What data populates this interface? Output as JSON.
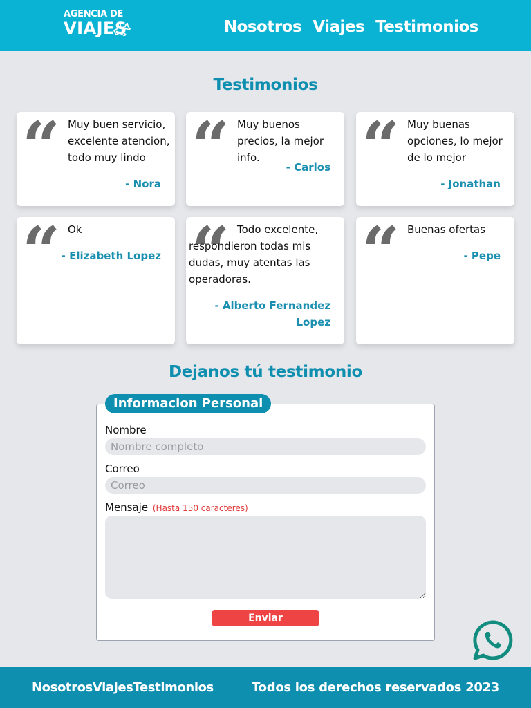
{
  "header": {
    "logo_line1": "AGENCIA DE",
    "logo_line2": "VIAJES",
    "nav": [
      "Nosotros",
      "Viajes",
      "Testimonios"
    ]
  },
  "testimonials": {
    "title": "Testimonios",
    "items": [
      {
        "text": "Muy buen servicio, excelente atencion, todo muy lindo",
        "author": "- Nora"
      },
      {
        "text": "Muy buenos precios, la mejor info.",
        "author": "- Carlos"
      },
      {
        "text": "Muy buenas opciones, lo mejor de lo mejor",
        "author": "- Jonathan"
      },
      {
        "text": "Ok",
        "author": "- Elizabeth Lopez"
      },
      {
        "text": "Todo excelente, respondieron todas mis dudas, muy atentas las operadoras.",
        "author": "- Alberto Fernandez Lopez"
      },
      {
        "text": "Buenas ofertas",
        "author": "- Pepe"
      }
    ]
  },
  "form": {
    "title": "Dejanos tú testimonio",
    "legend": "Informacion Personal",
    "name_label": "Nombre",
    "name_placeholder": "Nombre completo",
    "email_label": "Correo",
    "email_placeholder": "Correo",
    "message_label": "Mensaje",
    "message_hint": "(Hasta 150 caracteres)",
    "submit_label": "Enviar"
  },
  "footer": {
    "nav": [
      "Nosotros",
      "Viajes",
      "Testimonios"
    ],
    "copyright": "Todos los derechos reservados 2023"
  },
  "colors": {
    "header_bg": "#0ab3d3",
    "footer_bg": "#0e8fb0",
    "accent": "#0e8fb0",
    "submit": "#ef4444",
    "whatsapp": "#128c7e"
  }
}
